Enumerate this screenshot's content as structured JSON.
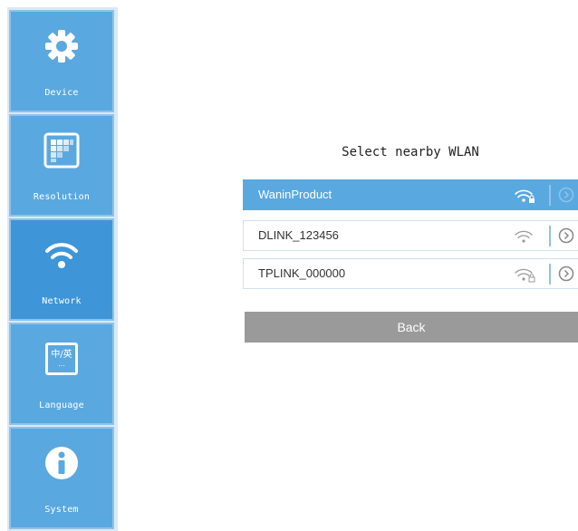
{
  "sidebar": {
    "items": [
      {
        "label": "Device",
        "icon": "gear-icon"
      },
      {
        "label": "Resolution",
        "icon": "resolution-grid-icon"
      },
      {
        "label": "Network",
        "icon": "wifi-icon",
        "active": true
      },
      {
        "label": "Language",
        "icon": "language-icon",
        "icon_text": "中/英"
      },
      {
        "label": "System",
        "icon": "info-icon"
      }
    ]
  },
  "main": {
    "title": "Select nearby WLAN",
    "networks": [
      {
        "ssid": "WaninProduct",
        "selected": true,
        "locked": true
      },
      {
        "ssid": "DLINK_123456",
        "selected": false,
        "locked": false
      },
      {
        "ssid": "TPLINK_000000",
        "selected": false,
        "locked": true
      }
    ],
    "back_label": "Back"
  },
  "colors": {
    "accent": "#5aa8e0",
    "sidebar_bg": "#d9e9f6",
    "back_button": "#9a9a9a"
  }
}
